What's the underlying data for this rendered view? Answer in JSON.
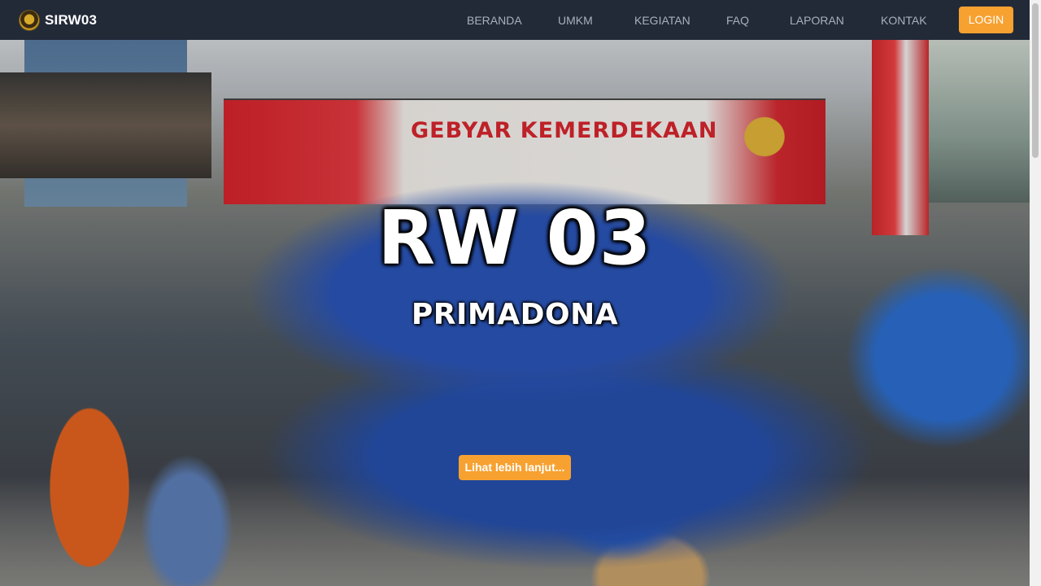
{
  "brand": {
    "name": "SIRW03",
    "logo_icon": "garuda-emblem-icon"
  },
  "nav": {
    "items": [
      {
        "label": "BERANDA"
      },
      {
        "label": "UMKM"
      },
      {
        "label": "KEGIATAN"
      },
      {
        "label": "FAQ"
      },
      {
        "label": "LAPORAN"
      },
      {
        "label": "KONTAK"
      }
    ],
    "login_label": "LOGIN"
  },
  "hero": {
    "title": "RW 03",
    "subtitle": "PRIMADONA",
    "button_label": "Lihat lebih lanjut...",
    "banner_text": "GEBYAR KEMERDEKAAN"
  },
  "colors": {
    "navbar_bg": "#222a38",
    "nav_text": "#a9b0bd",
    "accent": "#f7a131"
  }
}
